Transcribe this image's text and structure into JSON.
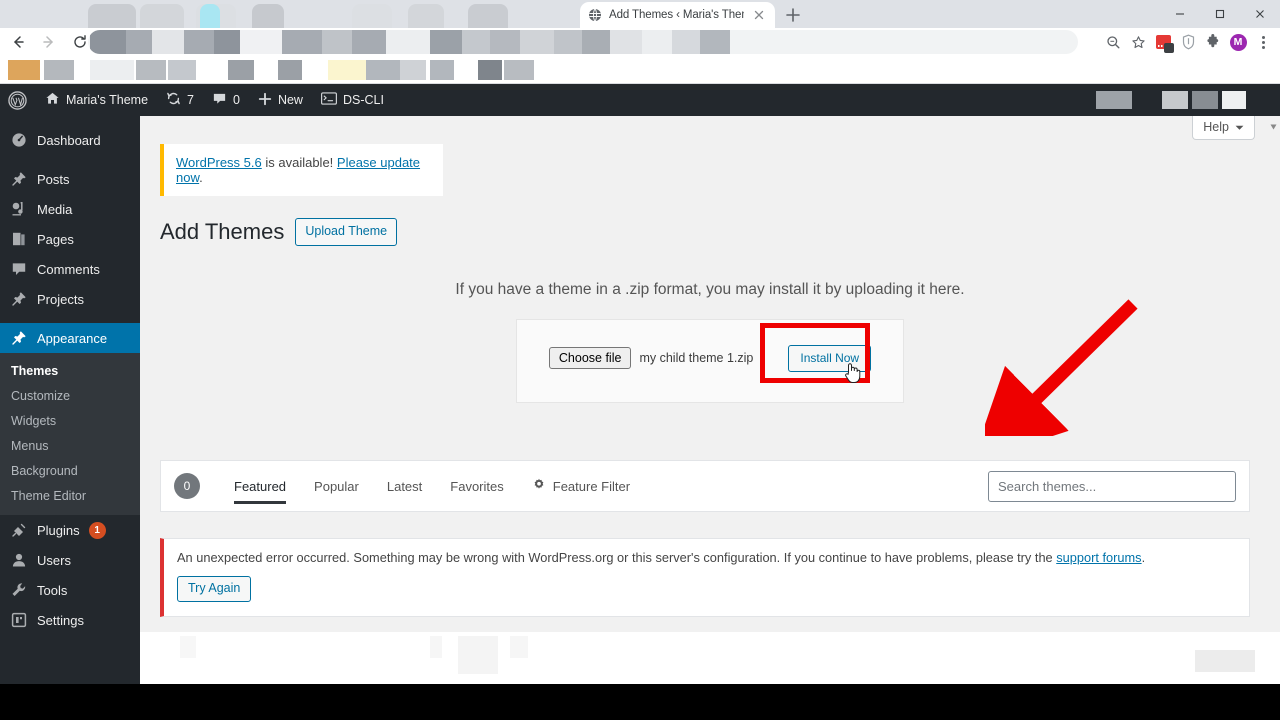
{
  "browser": {
    "tab": {
      "title": "Add Themes ‹ Maria's Theme —",
      "favicon_icon": "globe-icon",
      "close_icon": "close-icon"
    },
    "new_tab_icon": "plus-icon",
    "window_controls": {
      "minimize_icon": "minimize-icon",
      "maximize_icon": "maximize-icon",
      "close_icon": "close-icon"
    },
    "nav": {
      "back_icon": "back-arrow-icon",
      "forward_icon": "forward-arrow-icon",
      "reload_icon": "reload-icon"
    },
    "address_bar": {
      "value": "",
      "placeholder": ""
    },
    "toolbar_icons": [
      {
        "name": "zoom-icon",
        "label": ""
      },
      {
        "name": "bookmark-star-icon",
        "label": ""
      },
      {
        "name": "extension-red-icon",
        "label": "1"
      },
      {
        "name": "shield-extension-icon",
        "label": ""
      },
      {
        "name": "puzzle-extensions-icon",
        "label": ""
      },
      {
        "name": "profile-avatar",
        "label": "M"
      },
      {
        "name": "kebab-menu-icon",
        "label": ""
      }
    ]
  },
  "adminbar": {
    "wp_logo": "wordpress-logo-icon",
    "site": {
      "label": "Maria's Theme",
      "icon": "home-icon"
    },
    "updates": {
      "count": "7",
      "icon": "updates-icon"
    },
    "comments": {
      "count": "0",
      "icon": "comment-icon"
    },
    "new": {
      "label": "New",
      "icon": "plus-icon"
    },
    "dscli": {
      "label": "DS-CLI",
      "icon": "terminal-icon"
    }
  },
  "sidebar": {
    "items": [
      {
        "label": "Dashboard",
        "icon": "dashboard-icon"
      },
      {
        "label": "Posts",
        "icon": "pin-icon"
      },
      {
        "label": "Media",
        "icon": "media-icon"
      },
      {
        "label": "Pages",
        "icon": "pages-icon"
      },
      {
        "label": "Comments",
        "icon": "comment-icon"
      },
      {
        "label": "Projects",
        "icon": "pin-icon"
      },
      {
        "label": "Appearance",
        "icon": "paintbrush-icon",
        "current": true
      },
      {
        "label": "Plugins",
        "icon": "plug-icon",
        "badge": "1"
      },
      {
        "label": "Users",
        "icon": "user-icon"
      },
      {
        "label": "Tools",
        "icon": "wrench-icon"
      },
      {
        "label": "Settings",
        "icon": "settings-icon"
      }
    ],
    "submenu": [
      {
        "label": "Themes",
        "active": true
      },
      {
        "label": "Customize"
      },
      {
        "label": "Widgets"
      },
      {
        "label": "Menus"
      },
      {
        "label": "Background"
      },
      {
        "label": "Theme Editor"
      }
    ]
  },
  "help_tab": {
    "label": "Help",
    "caret_icon": "chevron-down-icon"
  },
  "update_nag": {
    "link_version": "WordPress 5.6",
    "mid_text": " is available! ",
    "link_update": "Please update now",
    "end_text": "."
  },
  "page": {
    "title": "Add Themes",
    "upload_theme_button": "Upload Theme",
    "upload_hint": "If you have a theme in a .zip format, you may install it by uploading it here.",
    "choose_file_button": "Choose file",
    "file_name": "my child theme 1.zip",
    "install_button": "Install Now"
  },
  "filterbar": {
    "count": "0",
    "tabs": [
      {
        "label": "Featured",
        "active": true
      },
      {
        "label": "Popular"
      },
      {
        "label": "Latest"
      },
      {
        "label": "Favorites"
      },
      {
        "label": "Feature Filter",
        "icon": "gear-icon"
      }
    ],
    "search_placeholder": "Search themes...",
    "search_value": ""
  },
  "error_notice": {
    "text": "An unexpected error occurred. Something may be wrong with WordPress.org or this server's configuration. If you continue to have problems, please try the ",
    "link": "support forums",
    "suffix": ".",
    "try_again_button": "Try Again"
  },
  "annotation": {
    "arrow_color": "#ee0000",
    "highlight_color": "#ee0000",
    "cursor": "pointer-hand-cursor"
  },
  "colors": {
    "wp_blue": "#0073aa",
    "admin_dark": "#23282d",
    "submenu_dark": "#32373c",
    "badge_orange": "#d54e21",
    "error_red": "#dc3232",
    "nag_yellow": "#ffb900"
  }
}
